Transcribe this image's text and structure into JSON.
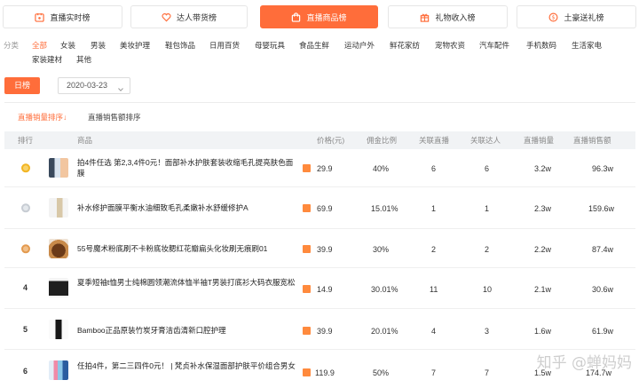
{
  "tabs": [
    {
      "label": "直播实时榜",
      "icon": "calendar-icon"
    },
    {
      "label": "达人带货榜",
      "icon": "heart-icon"
    },
    {
      "label": "直播商品榜",
      "icon": "bag-icon",
      "active": true
    },
    {
      "label": "礼物收入榜",
      "icon": "gift-icon"
    },
    {
      "label": "土豪送礼榜",
      "icon": "coin-icon"
    }
  ],
  "categories": {
    "label": "分类",
    "row1": [
      "全部",
      "女装",
      "男装",
      "美妆护理",
      "鞋包饰品",
      "日用百货",
      "母婴玩具",
      "食品生鲜",
      "运动户外",
      "鲜花家纺",
      "宠物农资",
      "汽车配件",
      "手机数码",
      "生活家电"
    ],
    "row2": [
      "家装建材",
      "其他"
    ],
    "active": "全部"
  },
  "period": {
    "day_label": "日榜",
    "date": "2020-03-23"
  },
  "sort_tabs": [
    {
      "label": "直播销量排序↓",
      "active": true
    },
    {
      "label": "直播销售额排序",
      "active": false
    }
  ],
  "table": {
    "headers": [
      "排行",
      "商品",
      "价格(元)",
      "佣金比例",
      "关联直播",
      "关联达人",
      "直播销量",
      "直播销售额"
    ],
    "rows": [
      {
        "rank": "1",
        "name": "拍4件任选 第2,3,4件0元！面部补水护肤套装收缩毛孔提亮肤色面膜",
        "price": "29.9",
        "commission": "40%",
        "live": "6",
        "kol": "6",
        "volume": "3.2w",
        "sales": "96.3w"
      },
      {
        "rank": "2",
        "name": "补水修护面膜平衡水油细致毛孔柔嫩补水舒缓修护A",
        "price": "69.9",
        "commission": "15.01%",
        "live": "1",
        "kol": "1",
        "volume": "2.3w",
        "sales": "159.6w"
      },
      {
        "rank": "3",
        "name": "55号魔术粉底刷不卡粉底妆腮红花瓣扁头化妆刷无痕刷01",
        "price": "39.9",
        "commission": "30%",
        "live": "2",
        "kol": "2",
        "volume": "2.2w",
        "sales": "87.4w"
      },
      {
        "rank": "4",
        "name": "夏季短袖t恤男士纯棉圆领潮流体恤半袖T男装打底衫大码衣服宽松",
        "price": "14.9",
        "commission": "30.01%",
        "live": "11",
        "kol": "10",
        "volume": "2.1w",
        "sales": "30.6w"
      },
      {
        "rank": "5",
        "name": "Bamboo正品原装竹炭牙膏洁齿清新口腔护理",
        "price": "39.9",
        "commission": "20.01%",
        "live": "4",
        "kol": "3",
        "volume": "1.6w",
        "sales": "61.9w"
      },
      {
        "rank": "6",
        "name": "任拍4件，第二三四件0元！ | 梵贞补水保湿面部护肤平价组合男女",
        "price": "119.9",
        "commission": "50%",
        "live": "7",
        "kol": "7",
        "volume": "1.5w",
        "sales": "174.7w"
      }
    ]
  },
  "watermark": "知乎 @蝉妈妈",
  "colors": {
    "accent": "#ff6d3a",
    "gold": "#f2b523",
    "silver": "#c7ccd3",
    "bronze": "#e39a4f",
    "tmall": "#ff8a3d"
  }
}
